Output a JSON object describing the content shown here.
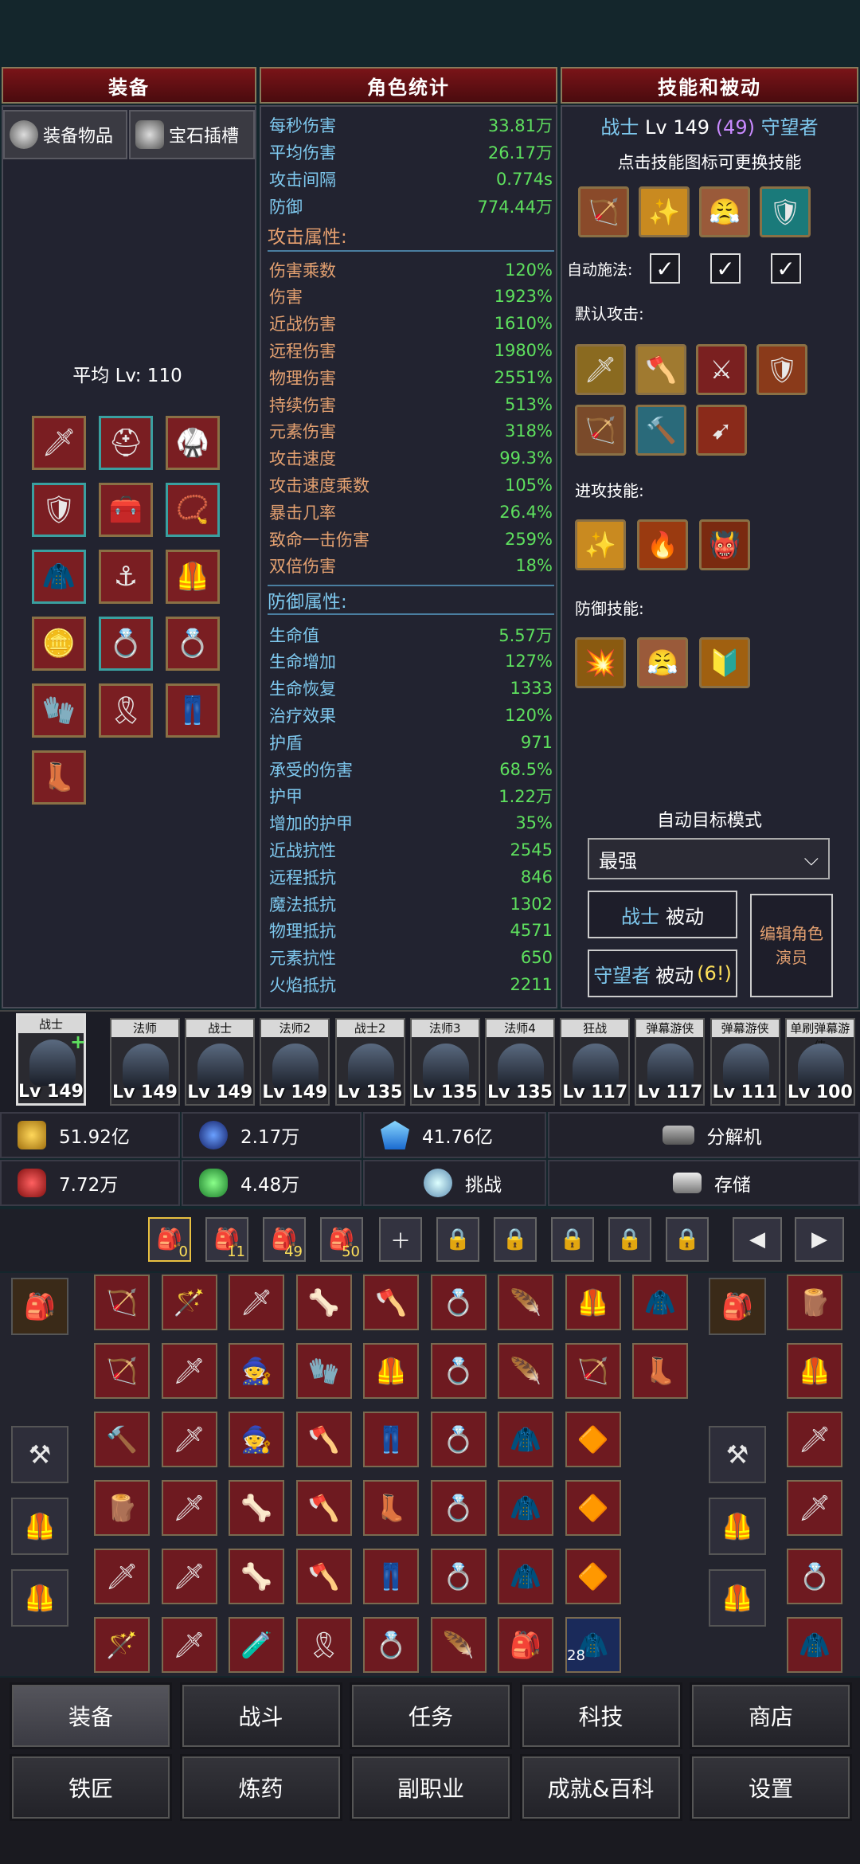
{
  "headers": {
    "equipment": "装备",
    "stats": "角色统计",
    "skills": "技能和被动"
  },
  "equip_tabs": {
    "items": "装备物品",
    "gems": "宝石插槽"
  },
  "avg_level": "平均 Lv: 110",
  "equip_slots": [
    "scimitar-icon",
    "hood-icon",
    "pauldron-icon",
    "shield-icon",
    "chest-icon",
    "amulet-icon",
    "cape-icon",
    "anchor-icon",
    "armor-icon",
    "coin-icon",
    "ring-icon",
    "gold-ring-icon",
    "gauntlet-icon",
    "belt-icon",
    "legs-icon",
    "boot-icon"
  ],
  "stats_top": [
    {
      "k": "每秒伤害",
      "v": "33.81万"
    },
    {
      "k": "平均伤害",
      "v": "26.17万"
    },
    {
      "k": "攻击间隔",
      "v": "0.774s"
    },
    {
      "k": "防御",
      "v": "774.44万"
    }
  ],
  "attack_title": "攻击属性:",
  "attack_stats": [
    {
      "k": "伤害乘数",
      "v": "120%"
    },
    {
      "k": "伤害",
      "v": "1923%"
    },
    {
      "k": "近战伤害",
      "v": "1610%"
    },
    {
      "k": "远程伤害",
      "v": "1980%"
    },
    {
      "k": "物理伤害",
      "v": "2551%"
    },
    {
      "k": "持续伤害",
      "v": "513%"
    },
    {
      "k": "元素伤害",
      "v": "318%"
    },
    {
      "k": "攻击速度",
      "v": "99.3%"
    },
    {
      "k": "攻击速度乘数",
      "v": "105%"
    },
    {
      "k": "暴击几率",
      "v": "26.4%"
    },
    {
      "k": "致命一击伤害",
      "v": "259%"
    },
    {
      "k": "双倍伤害",
      "v": "18%"
    }
  ],
  "defense_title": "防御属性:",
  "defense_stats": [
    {
      "k": "生命值",
      "v": "5.57万"
    },
    {
      "k": "生命增加",
      "v": "127%"
    },
    {
      "k": "生命恢复",
      "v": "1333"
    },
    {
      "k": "治疗效果",
      "v": "120%"
    },
    {
      "k": "护盾",
      "v": "971"
    },
    {
      "k": "承受的伤害",
      "v": "68.5%"
    },
    {
      "k": "护甲",
      "v": "1.22万"
    },
    {
      "k": "增加的护甲",
      "v": "35%"
    },
    {
      "k": "近战抗性",
      "v": "2545"
    },
    {
      "k": "远程抵抗",
      "v": "846"
    },
    {
      "k": "魔法抵抗",
      "v": "1302"
    },
    {
      "k": "物理抵抗",
      "v": "4571"
    },
    {
      "k": "元素抗性",
      "v": "650"
    },
    {
      "k": "火焰抵抗",
      "v": "2211"
    }
  ],
  "class_line": {
    "cls": "战士",
    "lv": "Lv 149",
    "sub": "(49)",
    "sub2": "守望者"
  },
  "skill_hint": "点击技能图标可更换技能",
  "auto_cast": "自动施法:",
  "default_attack": "默认攻击:",
  "offense_skills": "进攻技能:",
  "defense_skills": "防御技能:",
  "auto_target": "自动目标模式",
  "target_select": "最强",
  "warrior_passive": {
    "a": "战士",
    "b": "被动"
  },
  "guard_passive": {
    "a": "守望者",
    "b": "被动",
    "n": "(6!)"
  },
  "edit_roles": "编辑角色演员",
  "heroes": [
    {
      "name": "战士",
      "lv": "Lv 149"
    },
    {
      "name": "法师",
      "lv": "Lv 149"
    },
    {
      "name": "战士",
      "lv": "Lv 149"
    },
    {
      "name": "法师2",
      "lv": "Lv 149"
    },
    {
      "name": "战士2",
      "lv": "Lv 135"
    },
    {
      "name": "法师3",
      "lv": "Lv 135"
    },
    {
      "name": "法师4",
      "lv": "Lv 135"
    },
    {
      "name": "狂战",
      "lv": "Lv 117"
    },
    {
      "name": "弹幕游侠",
      "lv": "Lv 117"
    },
    {
      "name": "弹幕游侠",
      "lv": "Lv 111"
    },
    {
      "name": "单刷弹幕游侠",
      "lv": "Lv 100"
    }
  ],
  "currency": {
    "gold": "51.92亿",
    "orb": "2.17万",
    "gem": "41.76亿",
    "ruby": "7.72万",
    "jade": "4.48万"
  },
  "actions": {
    "salvage": "分解机",
    "challenge": "挑战",
    "storage": "存储"
  },
  "bag_tabs": [
    "0",
    "11",
    "49",
    "50"
  ],
  "colors": {
    "accent": "#5ee05e",
    "header": "#7a1418",
    "label": "#e3a070",
    "blue": "#7ec8ee"
  },
  "nav": [
    "装备",
    "战斗",
    "任务",
    "科技",
    "商店",
    "铁匠",
    "炼药",
    "副职业",
    "成就&百科",
    "设置"
  ],
  "stack_count": "28"
}
